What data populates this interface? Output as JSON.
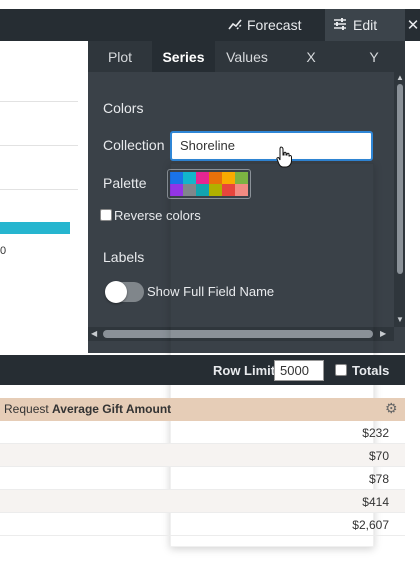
{
  "toolbar": {
    "forecast_label": "Forecast",
    "edit_label": "Edit",
    "close_glyph": "✕"
  },
  "viz": {
    "axis_tick": "0",
    "bar_color": "#26b5cf"
  },
  "panel": {
    "tabs": [
      "Plot",
      "Series",
      "Values",
      "X",
      "Y"
    ],
    "active_tab": "Series",
    "colors_heading": "Colors",
    "collection_label": "Collection",
    "collection_value": "Shoreline",
    "palette_label": "Palette",
    "palette_colors": [
      "#1a73e8",
      "#12b5cb",
      "#e52592",
      "#e8710a",
      "#f9ab00",
      "#7cb342",
      "#9334e6",
      "#80868b",
      "#12a4af",
      "#b0b000",
      "#e8453c",
      "#f28b82"
    ],
    "reverse_colors_label": "Reverse colors",
    "labels_heading": "Labels",
    "show_full_field_name_label": "Show Full Field Name"
  },
  "databar": {
    "row_limit_label": "Row Limit",
    "row_limit_value": "5000",
    "totals_label": "Totals"
  },
  "table": {
    "header_prefix": "Request",
    "header_bold": "Average Gift Amount",
    "rows": [
      "$232",
      "$70",
      "$78",
      "$414",
      "$2,607"
    ]
  }
}
